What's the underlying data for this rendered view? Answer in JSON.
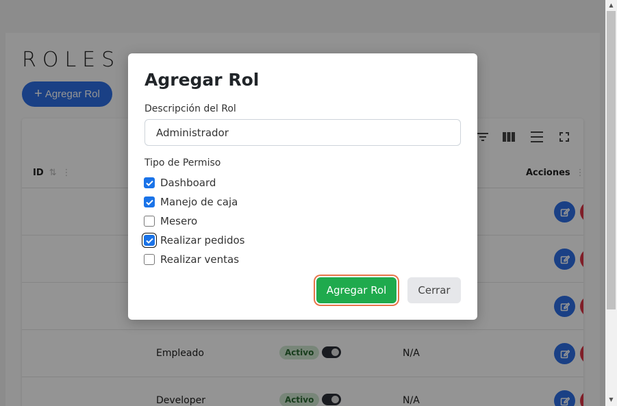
{
  "page": {
    "title": "ROLES",
    "add_button_label": "Agregar Rol",
    "add_button_icon": "plus-icon"
  },
  "table": {
    "headers": {
      "id": "ID",
      "actions": "Acciones"
    },
    "rows": [
      {
        "name": "",
        "status": "",
        "extra": ""
      },
      {
        "name": "",
        "status": "",
        "extra": ""
      },
      {
        "name": "",
        "status": "",
        "extra": ""
      },
      {
        "name": "Empleado",
        "status": "Activo",
        "extra": "N/A"
      },
      {
        "name": "Developer",
        "status": "Activo",
        "extra": "N/A"
      }
    ]
  },
  "modal": {
    "title": "Agregar Rol",
    "description_label": "Descripción del Rol",
    "description_value": "Administrador",
    "permissions_label": "Tipo de Permiso",
    "permissions": [
      {
        "label": "Dashboard",
        "checked": true
      },
      {
        "label": "Manejo de caja",
        "checked": true
      },
      {
        "label": "Mesero",
        "checked": false
      },
      {
        "label": "Realizar pedidos",
        "checked": true
      },
      {
        "label": "Realizar ventas",
        "checked": false
      }
    ],
    "submit_label": "Agregar Rol",
    "close_label": "Cerrar"
  },
  "colors": {
    "primary_blue": "#2d6fe6",
    "success_green": "#1faa4d",
    "focus_ring": "#e8754a",
    "danger_red": "#dc3545",
    "badge_bg": "#cfe7d1"
  }
}
